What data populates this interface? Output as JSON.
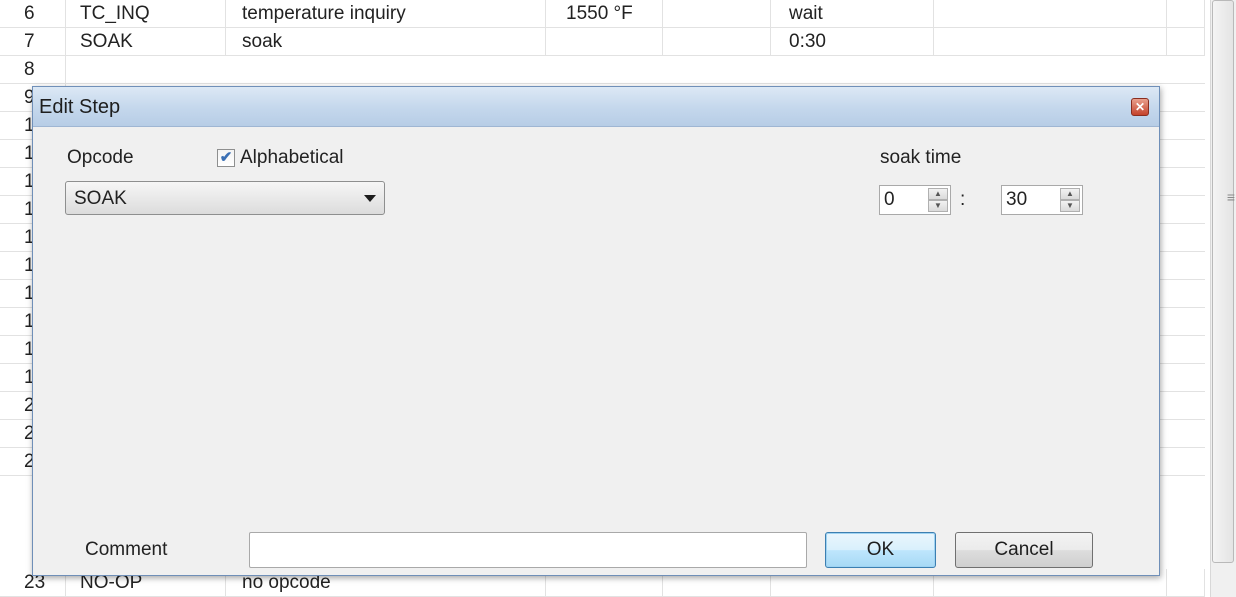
{
  "grid": {
    "rows": [
      {
        "num": "6",
        "opcode": "TC_INQ",
        "desc": "temperature inquiry",
        "temp": "1550 °F",
        "col5": "",
        "param": "wait"
      },
      {
        "num": "7",
        "opcode": "SOAK",
        "desc": "soak",
        "temp": "",
        "col5": "",
        "param": "0:30"
      },
      {
        "num": "23",
        "opcode": "NO-OP",
        "desc": "no opcode",
        "temp": "",
        "col5": "",
        "param": ""
      }
    ],
    "row_peeks": [
      "8",
      "9",
      "1",
      "1",
      "1",
      "1",
      "1",
      "1",
      "1",
      "1",
      "1",
      "1",
      "2",
      "2",
      "2"
    ]
  },
  "dialog": {
    "title": "Edit Step",
    "close_glyph": "✕",
    "opcode_label": "Opcode",
    "alphabetical_label": "Alphabetical",
    "alphabetical_checked": true,
    "opcode_value": "SOAK",
    "soak_time_label": "soak time",
    "soak_hours": "0",
    "soak_minutes": "30",
    "separator": ":",
    "comment_label": "Comment",
    "comment_value": "",
    "ok_label": "OK",
    "cancel_label": "Cancel"
  },
  "icons": {
    "check": "✔",
    "spin_up": "▲",
    "spin_down": "▼",
    "grip": "≡"
  }
}
